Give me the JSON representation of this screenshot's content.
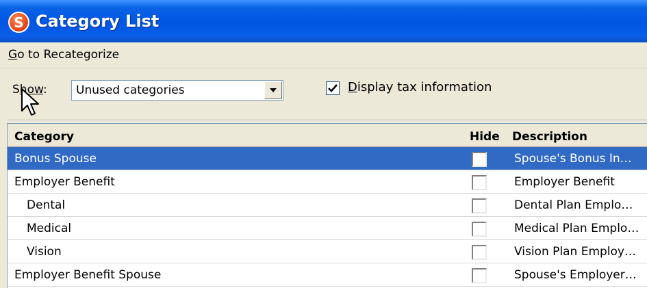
{
  "window": {
    "title": "Category List",
    "app_icon_glyph": "S"
  },
  "menu": {
    "recategorize_prefix": "G",
    "recategorize_rest": "o to Recategorize"
  },
  "filter": {
    "show_prefix": "S",
    "show_underlined": "how",
    "show_suffix": ":",
    "selected": "Unused categories",
    "dropdown_arrow_icon": "triangle-down"
  },
  "tax_option": {
    "checked": true,
    "label_underlined": "D",
    "label_rest": "isplay tax information"
  },
  "grid": {
    "columns": {
      "category": "Category",
      "hide": "Hide",
      "description": "Description"
    },
    "rows": [
      {
        "name": "Bonus Spouse",
        "indent": false,
        "description": "Spouse's Bonus In…",
        "selected": true
      },
      {
        "name": "Employer Benefit",
        "indent": false,
        "description": "Employer Benefit",
        "selected": false
      },
      {
        "name": "Dental",
        "indent": true,
        "description": "Dental Plan Emplo…",
        "selected": false
      },
      {
        "name": "Medical",
        "indent": true,
        "description": "Medical Plan Emplo…",
        "selected": false
      },
      {
        "name": "Vision",
        "indent": true,
        "description": "Vision Plan Employ…",
        "selected": false
      },
      {
        "name": "Employer Benefit Spouse",
        "indent": false,
        "description": "Spouse's Employer…",
        "selected": false
      }
    ]
  },
  "colors": {
    "title_bar": "#0055e2",
    "selection": "#316ac5",
    "window_bg": "#ece9d8"
  }
}
